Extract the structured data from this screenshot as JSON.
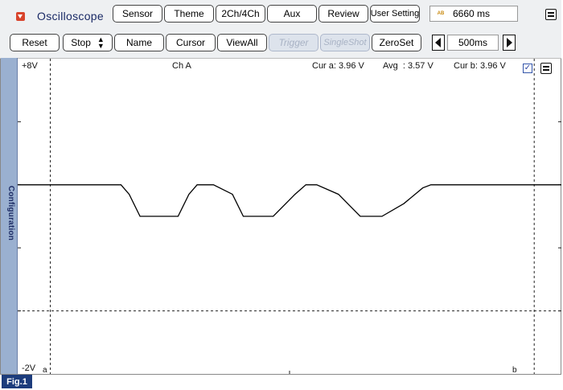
{
  "app": {
    "title": "Oscilloscope",
    "top_buttons": [
      "Sensor",
      "Theme",
      "2Ch/4Ch",
      "Aux",
      "Review",
      "User Setting"
    ],
    "timer": {
      "badge": "AB",
      "value": "6660 ms"
    }
  },
  "controls": {
    "reset": "Reset",
    "run_state": "Stop",
    "name": "Name",
    "cursor": "Cursor",
    "view_all": "ViewAll",
    "trigger": "Trigger",
    "single_shot": "SingleShot",
    "zero_set": "ZeroSet",
    "timebase": "500ms"
  },
  "sidebar": {
    "label": "Configuration"
  },
  "plot": {
    "y_max_label": "+8V",
    "y_min_label": "-2V",
    "channel_label": "Ch A",
    "cur_a_label": "Cur a",
    "cur_a_value": "3.96 V",
    "avg_label": "Avg",
    "avg_value": "3.57 V",
    "cur_b_label": "Cur b",
    "cur_b_value": "3.96 V",
    "cursor_a_marker": "a",
    "cursor_b_marker": "b",
    "checkbox_checked": true
  },
  "figure_label": "Fig.1",
  "chart_data": {
    "type": "line",
    "title": "Ch A",
    "xlabel": "",
    "ylabel": "",
    "ylim": [
      -2,
      8
    ],
    "x_unit": "divisions",
    "xlim": [
      0,
      10
    ],
    "grid": "dashed reference line at 0 V; dashed cursor lines a and b",
    "series": [
      {
        "color": "#000000",
        "x": [
          0,
          1.9,
          2.05,
          2.25,
          2.6,
          2.95,
          3.15,
          3.3,
          3.6,
          3.95,
          4.15,
          4.35,
          4.7,
          5.1,
          5.3,
          5.5,
          5.9,
          6.3,
          6.5,
          6.7,
          7.1,
          7.45,
          7.6,
          10
        ],
        "y": [
          4.0,
          4.0,
          3.7,
          3.0,
          3.0,
          3.0,
          3.7,
          4.0,
          4.0,
          3.7,
          3.0,
          3.0,
          3.0,
          3.7,
          4.0,
          4.0,
          3.7,
          3.0,
          3.0,
          3.0,
          3.4,
          3.9,
          4.0,
          4.0
        ]
      }
    ],
    "cursors": {
      "a": 0.6,
      "b": 9.5
    },
    "reference_level_v": 0
  }
}
